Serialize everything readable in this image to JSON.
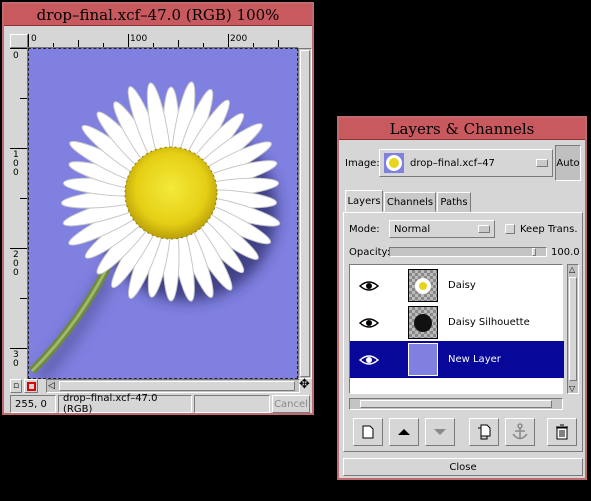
{
  "image_window": {
    "title": "drop–final.xcf–47.0 (RGB) 100%",
    "ruler_h_labels": [
      "0",
      "100",
      "200"
    ],
    "ruler_v_labels": [
      "0",
      "1 0 0",
      "2 0 0",
      "3 0"
    ],
    "status": {
      "coords": "255, 0",
      "info": "drop–final.xcf–47.0 (RGB)",
      "cancel_label": "Cancel"
    },
    "canvas_bg": "#7f80e0"
  },
  "layers_window": {
    "title": "Layers & Channels",
    "image_label": "Image:",
    "image_value": "drop–final.xcf–47",
    "auto_label": "Auto",
    "tabs": [
      {
        "label": "Layers",
        "active": true
      },
      {
        "label": "Channels",
        "active": false
      },
      {
        "label": "Paths",
        "active": false
      }
    ],
    "mode_label": "Mode:",
    "mode_value": "Normal",
    "keep_trans_label": "Keep Trans.",
    "opacity_label": "Opacity:",
    "opacity_value": "100.0",
    "layers": [
      {
        "name": "Daisy",
        "visible": true,
        "selected": false
      },
      {
        "name": "Daisy Silhouette",
        "visible": true,
        "selected": false
      },
      {
        "name": "New Layer",
        "visible": true,
        "selected": true
      }
    ],
    "toolbar": [
      "new-layer-icon",
      "raise-layer-icon",
      "lower-layer-icon",
      "duplicate-layer-icon",
      "anchor-icon",
      "delete-layer-icon"
    ],
    "close_label": "Close",
    "selection_color": "#07079a"
  }
}
